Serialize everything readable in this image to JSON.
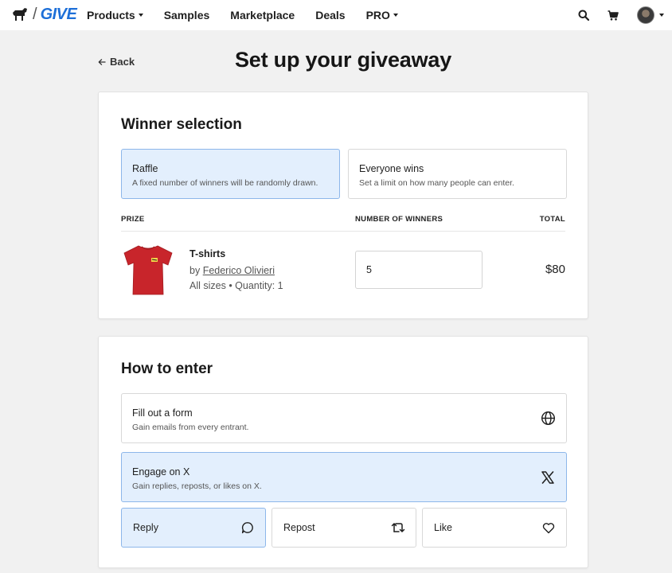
{
  "nav": {
    "logo_text": "GIVE",
    "items": [
      {
        "label": "Products",
        "dropdown": true
      },
      {
        "label": "Samples",
        "dropdown": false
      },
      {
        "label": "Marketplace",
        "dropdown": false
      },
      {
        "label": "Deals",
        "dropdown": false
      },
      {
        "label": "PRO",
        "dropdown": true
      }
    ]
  },
  "header": {
    "back_label": "Back",
    "title": "Set up your giveaway"
  },
  "winner_selection": {
    "title": "Winner selection",
    "options": [
      {
        "title": "Raffle",
        "desc": "A fixed number of winners will be randomly drawn.",
        "selected": true
      },
      {
        "title": "Everyone wins",
        "desc": "Set a limit on how many people can enter.",
        "selected": false
      }
    ],
    "columns": {
      "prize": "PRIZE",
      "winners": "NUMBER OF WINNERS",
      "total": "TOTAL"
    },
    "prize": {
      "name": "T-shirts",
      "by_prefix": "by ",
      "creator": "Federico Olivieri",
      "meta": "All sizes • Quantity: 1",
      "winners_value": "5",
      "total": "$80"
    }
  },
  "how_to_enter": {
    "title": "How to enter",
    "options": [
      {
        "title": "Fill out a form",
        "desc": "Gain emails from every entrant.",
        "icon": "globe-icon",
        "selected": false
      },
      {
        "title": "Engage on X",
        "desc": "Gain replies, reposts, or likes on X.",
        "icon": "x-logo-icon",
        "selected": true
      }
    ],
    "engagements": [
      {
        "label": "Reply",
        "icon": "comment-icon",
        "selected": true
      },
      {
        "label": "Repost",
        "icon": "repost-icon",
        "selected": false
      },
      {
        "label": "Like",
        "icon": "heart-icon",
        "selected": false
      }
    ]
  },
  "colors": {
    "accent": "#1d6fd8",
    "selected_bg": "#e3effd",
    "selected_border": "#8db7ea",
    "tshirt": "#c8252b"
  }
}
